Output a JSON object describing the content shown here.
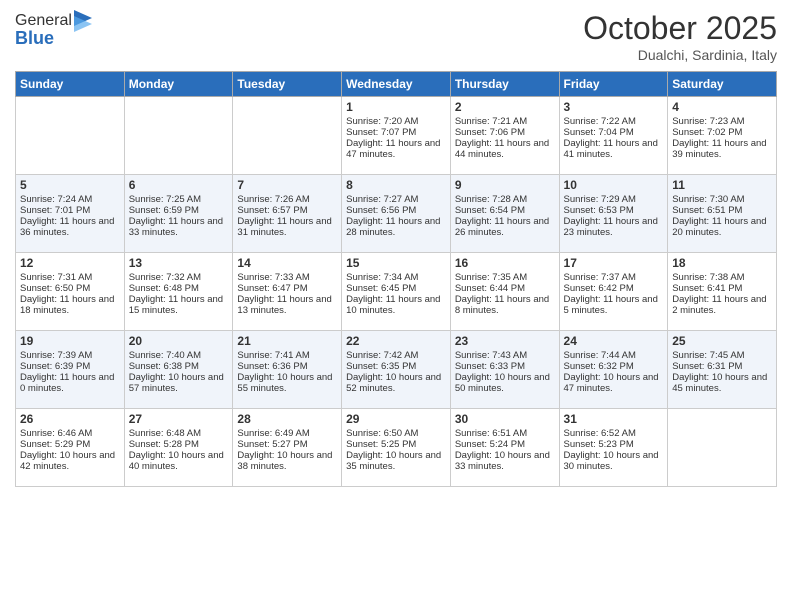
{
  "header": {
    "logo_line1": "General",
    "logo_line2": "Blue",
    "month_title": "October 2025",
    "location": "Dualchi, Sardinia, Italy"
  },
  "days_of_week": [
    "Sunday",
    "Monday",
    "Tuesday",
    "Wednesday",
    "Thursday",
    "Friday",
    "Saturday"
  ],
  "weeks": [
    [
      {
        "day": "",
        "content": ""
      },
      {
        "day": "",
        "content": ""
      },
      {
        "day": "",
        "content": ""
      },
      {
        "day": "1",
        "content": "Sunrise: 7:20 AM\nSunset: 7:07 PM\nDaylight: 11 hours and 47 minutes."
      },
      {
        "day": "2",
        "content": "Sunrise: 7:21 AM\nSunset: 7:06 PM\nDaylight: 11 hours and 44 minutes."
      },
      {
        "day": "3",
        "content": "Sunrise: 7:22 AM\nSunset: 7:04 PM\nDaylight: 11 hours and 41 minutes."
      },
      {
        "day": "4",
        "content": "Sunrise: 7:23 AM\nSunset: 7:02 PM\nDaylight: 11 hours and 39 minutes."
      }
    ],
    [
      {
        "day": "5",
        "content": "Sunrise: 7:24 AM\nSunset: 7:01 PM\nDaylight: 11 hours and 36 minutes."
      },
      {
        "day": "6",
        "content": "Sunrise: 7:25 AM\nSunset: 6:59 PM\nDaylight: 11 hours and 33 minutes."
      },
      {
        "day": "7",
        "content": "Sunrise: 7:26 AM\nSunset: 6:57 PM\nDaylight: 11 hours and 31 minutes."
      },
      {
        "day": "8",
        "content": "Sunrise: 7:27 AM\nSunset: 6:56 PM\nDaylight: 11 hours and 28 minutes."
      },
      {
        "day": "9",
        "content": "Sunrise: 7:28 AM\nSunset: 6:54 PM\nDaylight: 11 hours and 26 minutes."
      },
      {
        "day": "10",
        "content": "Sunrise: 7:29 AM\nSunset: 6:53 PM\nDaylight: 11 hours and 23 minutes."
      },
      {
        "day": "11",
        "content": "Sunrise: 7:30 AM\nSunset: 6:51 PM\nDaylight: 11 hours and 20 minutes."
      }
    ],
    [
      {
        "day": "12",
        "content": "Sunrise: 7:31 AM\nSunset: 6:50 PM\nDaylight: 11 hours and 18 minutes."
      },
      {
        "day": "13",
        "content": "Sunrise: 7:32 AM\nSunset: 6:48 PM\nDaylight: 11 hours and 15 minutes."
      },
      {
        "day": "14",
        "content": "Sunrise: 7:33 AM\nSunset: 6:47 PM\nDaylight: 11 hours and 13 minutes."
      },
      {
        "day": "15",
        "content": "Sunrise: 7:34 AM\nSunset: 6:45 PM\nDaylight: 11 hours and 10 minutes."
      },
      {
        "day": "16",
        "content": "Sunrise: 7:35 AM\nSunset: 6:44 PM\nDaylight: 11 hours and 8 minutes."
      },
      {
        "day": "17",
        "content": "Sunrise: 7:37 AM\nSunset: 6:42 PM\nDaylight: 11 hours and 5 minutes."
      },
      {
        "day": "18",
        "content": "Sunrise: 7:38 AM\nSunset: 6:41 PM\nDaylight: 11 hours and 2 minutes."
      }
    ],
    [
      {
        "day": "19",
        "content": "Sunrise: 7:39 AM\nSunset: 6:39 PM\nDaylight: 11 hours and 0 minutes."
      },
      {
        "day": "20",
        "content": "Sunrise: 7:40 AM\nSunset: 6:38 PM\nDaylight: 10 hours and 57 minutes."
      },
      {
        "day": "21",
        "content": "Sunrise: 7:41 AM\nSunset: 6:36 PM\nDaylight: 10 hours and 55 minutes."
      },
      {
        "day": "22",
        "content": "Sunrise: 7:42 AM\nSunset: 6:35 PM\nDaylight: 10 hours and 52 minutes."
      },
      {
        "day": "23",
        "content": "Sunrise: 7:43 AM\nSunset: 6:33 PM\nDaylight: 10 hours and 50 minutes."
      },
      {
        "day": "24",
        "content": "Sunrise: 7:44 AM\nSunset: 6:32 PM\nDaylight: 10 hours and 47 minutes."
      },
      {
        "day": "25",
        "content": "Sunrise: 7:45 AM\nSunset: 6:31 PM\nDaylight: 10 hours and 45 minutes."
      }
    ],
    [
      {
        "day": "26",
        "content": "Sunrise: 6:46 AM\nSunset: 5:29 PM\nDaylight: 10 hours and 42 minutes."
      },
      {
        "day": "27",
        "content": "Sunrise: 6:48 AM\nSunset: 5:28 PM\nDaylight: 10 hours and 40 minutes."
      },
      {
        "day": "28",
        "content": "Sunrise: 6:49 AM\nSunset: 5:27 PM\nDaylight: 10 hours and 38 minutes."
      },
      {
        "day": "29",
        "content": "Sunrise: 6:50 AM\nSunset: 5:25 PM\nDaylight: 10 hours and 35 minutes."
      },
      {
        "day": "30",
        "content": "Sunrise: 6:51 AM\nSunset: 5:24 PM\nDaylight: 10 hours and 33 minutes."
      },
      {
        "day": "31",
        "content": "Sunrise: 6:52 AM\nSunset: 5:23 PM\nDaylight: 10 hours and 30 minutes."
      },
      {
        "day": "",
        "content": ""
      }
    ]
  ]
}
